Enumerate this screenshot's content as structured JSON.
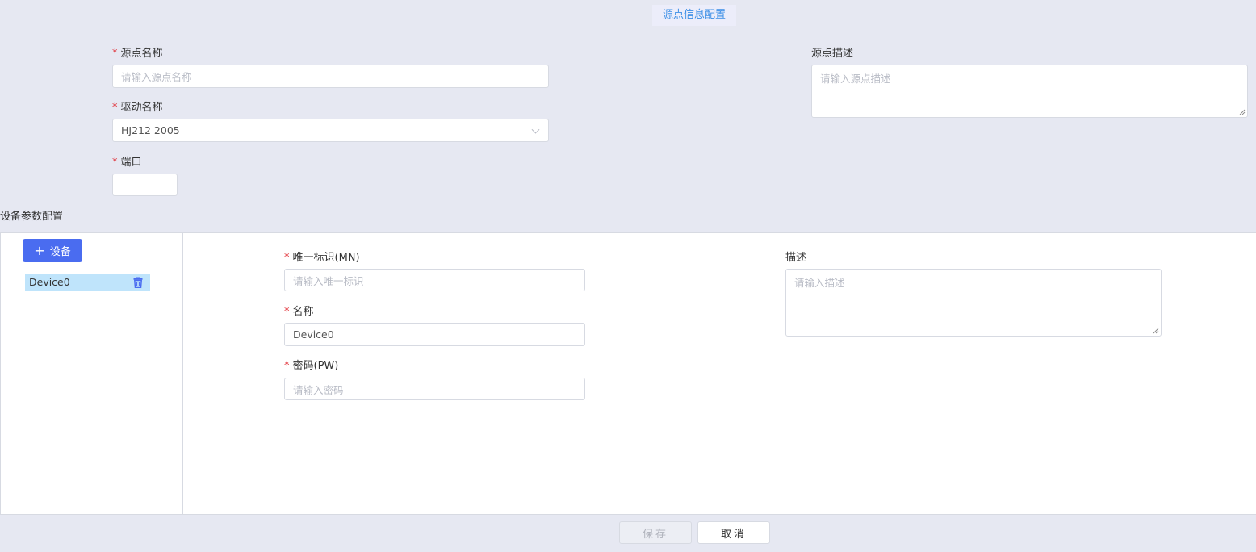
{
  "page_title": "源点信息配置",
  "source_form": {
    "name": {
      "label": "源点名称",
      "required": true,
      "placeholder": "请输入源点名称",
      "value": ""
    },
    "driver": {
      "label": "驱动名称",
      "required": true,
      "value": "HJ212 2005"
    },
    "port": {
      "label": "端口",
      "required": true,
      "value": ""
    },
    "description": {
      "label": "源点描述",
      "placeholder": "请输入源点描述"
    }
  },
  "device_section": {
    "title": "设备参数配置",
    "add_button_label": "设备",
    "devices": [
      {
        "name": "Device0",
        "selected": true
      }
    ],
    "form": {
      "mn": {
        "label": "唯一标识(MN)",
        "required": true,
        "placeholder": "请输入唯一标识"
      },
      "name": {
        "label": "名称",
        "required": true,
        "value": "Device0"
      },
      "password": {
        "label": "密码(PW)",
        "required": true,
        "placeholder": "请输入密码"
      },
      "description": {
        "label": "描述",
        "placeholder": "请输入描述"
      }
    }
  },
  "footer": {
    "save_label": "保存",
    "cancel_label": "取消"
  },
  "colors": {
    "background": "#e6e8f2",
    "accent": "#4a6cf0",
    "title": "#3a8ee6",
    "required": "#e0242c",
    "selected_item": "#bfe4fb"
  },
  "icons": [
    "plus-icon",
    "trash-icon",
    "chevron-down-icon"
  ]
}
